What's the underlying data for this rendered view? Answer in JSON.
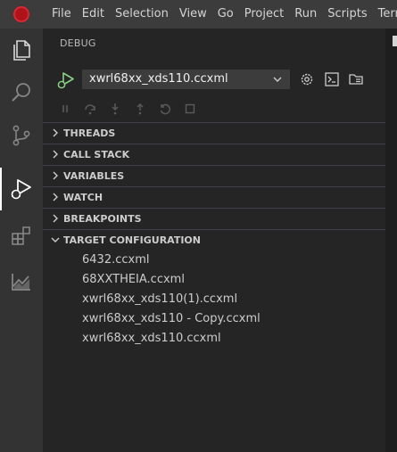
{
  "menubar": {
    "items": [
      "File",
      "Edit",
      "Selection",
      "View",
      "Go",
      "Project",
      "Run",
      "Scripts",
      "Term"
    ]
  },
  "activitybar": {
    "icons": [
      "files-icon",
      "search-icon",
      "source-control-icon",
      "run-debug-icon",
      "extensions-icon",
      "chart-icon"
    ],
    "active": "run-debug-icon"
  },
  "sidebar": {
    "title": "DEBUG",
    "config_selected": "xwrl68xx_xds110.ccxml",
    "sections": [
      {
        "label": "THREADS",
        "expanded": false
      },
      {
        "label": "CALL STACK",
        "expanded": false
      },
      {
        "label": "VARIABLES",
        "expanded": false
      },
      {
        "label": "WATCH",
        "expanded": false
      },
      {
        "label": "BREAKPOINTS",
        "expanded": false
      },
      {
        "label": "TARGET CONFIGURATION",
        "expanded": true
      }
    ],
    "target_configurations": [
      "6432.ccxml",
      "68XXTHEIA.ccxml",
      "xwrl68xx_xds110(1).ccxml",
      "xwrl68xx_xds110 - Copy.ccxml",
      "xwrl68xx_xds110.ccxml"
    ]
  },
  "colors": {
    "menubar_bg": "#3c3c3c",
    "activitybar_bg": "#333333",
    "sidebar_bg": "#252526",
    "accent_green": "#89d185",
    "logo_red": "#b0121c"
  }
}
